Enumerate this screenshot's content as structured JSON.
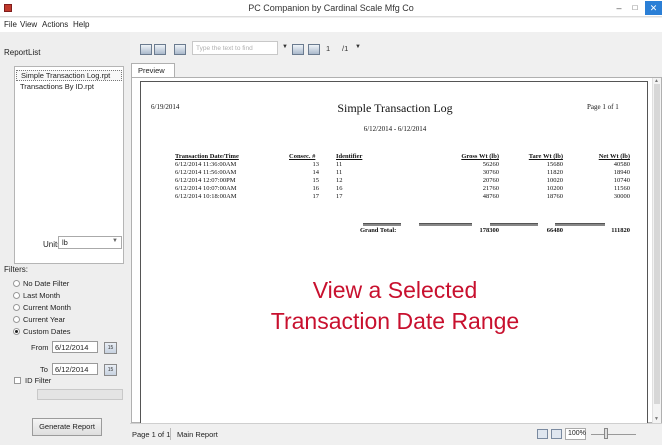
{
  "window": {
    "title": "PC Companion by Cardinal Scale Mfg Co"
  },
  "menu": [
    "File",
    "View",
    "Actions",
    "Help"
  ],
  "sidebar": {
    "report_list_label": "ReportList",
    "reports": [
      "Simple Transaction Log.rpt",
      "Transactions By ID.rpt"
    ],
    "units_label": "Units",
    "units_value": "lb",
    "filters_label": "Filters:",
    "filter_options": [
      "No Date Filter",
      "Last Month",
      "Current Month",
      "Current Year",
      "Custom Dates"
    ],
    "selected_filter": "Custom Dates",
    "from_label": "From",
    "from_value": "6/12/2014",
    "to_label": "To",
    "to_value": "6/12/2014",
    "id_filter_label": "ID Filter",
    "generate_label": "Generate Report"
  },
  "toolbar": {
    "search_placeholder": "Type the text to find",
    "page_current": "1",
    "page_total": "/1"
  },
  "tab_label": "Preview",
  "report": {
    "print_date": "6/19/2014",
    "title": "Simple Transaction Log",
    "page_label": "Page 1 of 1",
    "date_range": "6/12/2014 - 6/12/2014",
    "headers": [
      "Transaction Date/Time",
      "Consec. #",
      "Identifier",
      "Gross Wt (lb)",
      "Tare Wt (lb)",
      "Net Wt (lb)"
    ],
    "rows": [
      [
        "6/12/2014  11:36:00AM",
        "13",
        "11",
        "56260",
        "15680",
        "40580"
      ],
      [
        "6/12/2014  11:56:00AM",
        "14",
        "11",
        "30760",
        "11820",
        "18940"
      ],
      [
        "6/12/2014  12:07:00PM",
        "15",
        "12",
        "20760",
        "10020",
        "10740"
      ],
      [
        "6/12/2014  10:07:00AM",
        "16",
        "16",
        "21760",
        "10200",
        "11560"
      ],
      [
        "6/12/2014  10:18:00AM",
        "17",
        "17",
        "48760",
        "18760",
        "30000"
      ]
    ],
    "grand_total_label": "Grand Total:",
    "totals": [
      "178300",
      "66480",
      "111820"
    ]
  },
  "overlay": {
    "line1": "View a Selected",
    "line2": "Transaction Date Range",
    "color": "#c8102e"
  },
  "status": {
    "page": "Page 1 of 1",
    "report_name": "Main Report",
    "zoom": "100%"
  }
}
